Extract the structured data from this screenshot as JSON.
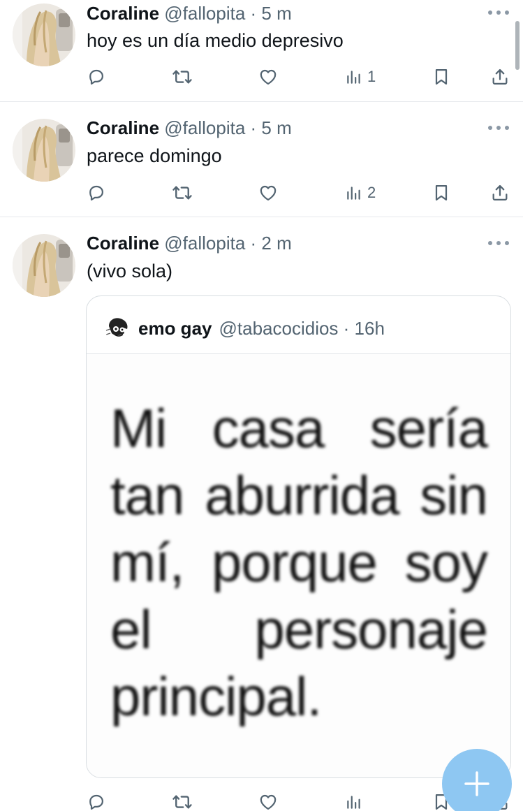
{
  "tweets": [
    {
      "author": "Coraline",
      "meta": "@fallopita · 5 m",
      "text": "hoy es un día medio depresivo",
      "views": "1"
    },
    {
      "author": "Coraline",
      "meta": "@fallopita · 5 m",
      "text": "parece domingo",
      "views": "2"
    },
    {
      "author": "Coraline",
      "meta": "@fallopita · 2 m",
      "text": "(vivo sola)",
      "views": "",
      "quote": {
        "author": "emo gay",
        "meta": "@tabacocidios · 16h",
        "image_text": "Mi casa sería tan aburrida sin mí, porque soy el personaje principal."
      }
    }
  ],
  "icons": {
    "reply": "reply-icon",
    "retweet": "retweet-icon",
    "like": "heart-icon",
    "views": "views-icon",
    "bookmark": "bookmark-icon",
    "share": "share-icon",
    "more": "more-icon",
    "compose": "plus-icon"
  },
  "colors": {
    "text": "#0f1419",
    "secondary": "#536471",
    "fab": "#8ec7f2"
  }
}
